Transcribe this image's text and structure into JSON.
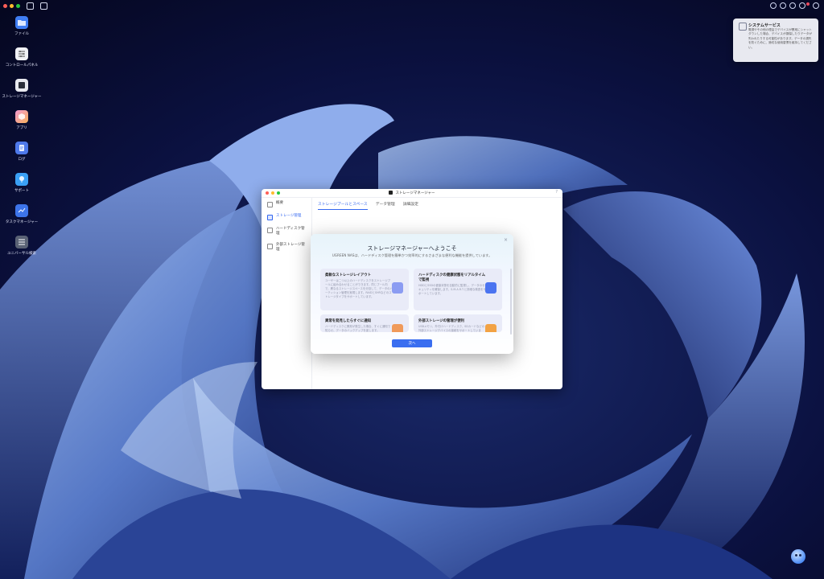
{
  "desktop_icons": [
    {
      "label": "ファイル",
      "icon": "folder-icon"
    },
    {
      "label": "コントロールパネル",
      "icon": "control-panel-icon"
    },
    {
      "label": "ストレージマネージャー",
      "icon": "storage-manager-icon"
    },
    {
      "label": "アプリ",
      "icon": "apps-icon"
    },
    {
      "label": "ログ",
      "icon": "log-icon"
    },
    {
      "label": "サポート",
      "icon": "support-icon"
    },
    {
      "label": "タスクマネージャー",
      "icon": "task-manager-icon"
    },
    {
      "label": "ユニバーサル検索",
      "icon": "universal-search-icon"
    }
  ],
  "notification": {
    "title": "システムサービス",
    "body": "電源やその他の理由でデバイスが異常にシャットダウンした場合、デバイスが損傷したりデータが失われたりする可能性があります。データの損失を防ぐために、適切な使用習慣を維持してください。"
  },
  "window": {
    "title": "ストレージマネージャー",
    "help": "?",
    "sidebar": [
      "概要",
      "ストレージ管理",
      "ハードディスク管理",
      "外部ストレージ管理"
    ],
    "tabs": [
      "ストレージプールとスペース",
      "データ管理",
      "詳細設定"
    ]
  },
  "dialog": {
    "title": "ストレージマネージャーへようこそ",
    "subtitle": "UGREEN NASは、ハードディスク管理を簡単かつ効率的にするさまざまな便利な機能を提供しています。",
    "cards": [
      {
        "title": "柔軟なストレージレイアウト",
        "desc": "ユーザーは二つ以上のハードディスクをストレージプールに組み合わせることができます。同じプール内で、異なるストレージスペースを分割して、データのパーティション管理を実現します。RAIDとSHRなどのストレージタイプをサポートしています。",
        "icon": "layout-icon",
        "color": "#8b9cf2"
      },
      {
        "title": "ハードディスクの健康状態をリアルタイムで監視",
        "desc": "HDDとSSDの健康状態を自動的に監視し、データのセキュリティを確保します。S.M.A.R.T.と詳細な検査をサポートしています。",
        "icon": "shield-check-icon",
        "color": "#4b74f0"
      },
      {
        "title": "異常を発見したらすぐに通知",
        "desc": "ハードディスクに異常が発生した場合、すぐに通知で知らせ、データのバックアップを促します。",
        "icon": "alert-bell-icon",
        "color": "#f09a5a"
      },
      {
        "title": "外部ストレージの管理が便利",
        "desc": "USBメモリ、外付けハードディスク、SDカードなどの外部ストレージデバイスの接続をサポートしています。",
        "icon": "external-storage-icon",
        "color": "#f2a244"
      }
    ],
    "next_label": "次へ",
    "close": "×"
  }
}
